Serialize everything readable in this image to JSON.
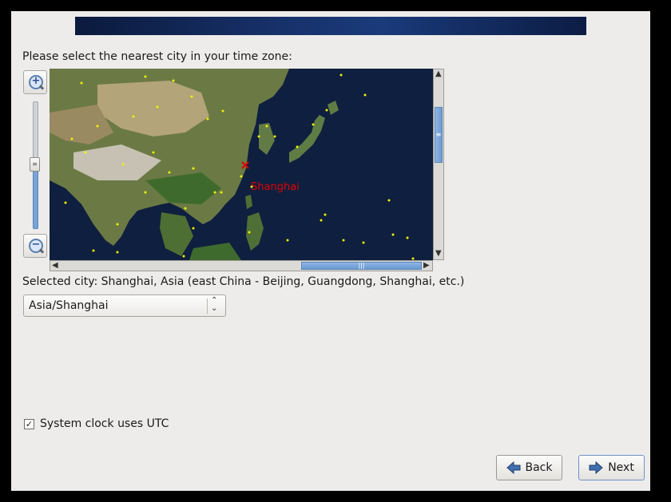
{
  "prompt": "Please select the nearest city in your time zone:",
  "map": {
    "selected_marker_label": "Shanghai"
  },
  "selected_city_text": "Selected city: Shanghai, Asia (east China - Beijing, Guangdong, Shanghai, etc.)",
  "timezone_combo": {
    "value": "Asia/Shanghai"
  },
  "utc_checkbox": {
    "label": "System clock uses UTC",
    "checked": true
  },
  "buttons": {
    "back": "Back",
    "next": "Next"
  },
  "icons": {
    "zoom_in": "zoom-in-icon",
    "zoom_out": "zoom-out-icon",
    "back": "left-arrow-icon",
    "next": "right-arrow-icon"
  },
  "colors": {
    "accent": "#6b9ad1",
    "marker": "#e00000",
    "city_dot": "#f2f200",
    "ocean": "#0f1f3f"
  }
}
